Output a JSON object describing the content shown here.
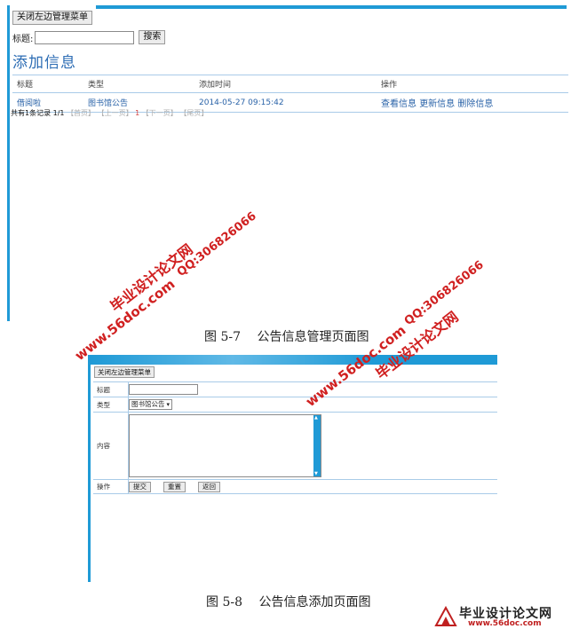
{
  "screen1": {
    "close_menu_button": "关闭左边管理菜单",
    "search": {
      "label": "标题:",
      "value": "",
      "button": "搜索"
    },
    "page_title": "添加信息",
    "table": {
      "headers": [
        "标题",
        "类型",
        "添加时间",
        "操作"
      ],
      "rows": [
        {
          "title": "借阅啦",
          "type": "图书馆公告",
          "time": "2014-05-27 09:15:42",
          "actions": [
            "查看信息",
            "更新信息",
            "删除信息"
          ]
        }
      ]
    },
    "pager": {
      "summary": "共有1条记录",
      "pages": "1/1",
      "first": "【首页】",
      "prev": "【上一页】",
      "current": "1",
      "next": "【下一页】",
      "last": "【尾页】"
    }
  },
  "caption1": "图 5-7　 公告信息管理页面图",
  "screen2": {
    "close_menu_button": "关闭左边管理菜单",
    "form": {
      "title_label": "标题",
      "title_value": "",
      "type_label": "类型",
      "type_selected": "图书馆公告",
      "content_label": "内容",
      "content_value": "",
      "actions_label": "操作",
      "buttons": [
        "提交",
        "重置",
        "返回"
      ]
    }
  },
  "caption2": "图 5-8　 公告信息添加页面图",
  "watermarks": [
    {
      "site": "www.56doc.com",
      "qq": "QQ:306826066",
      "title": "毕业设计论文网"
    },
    {
      "site": "www.56doc.com",
      "qq": "QQ:306826066",
      "title": "毕业设计论文网"
    }
  ],
  "logo": {
    "name": "毕业设计论文网",
    "site": "www.56doc.com"
  },
  "colors": {
    "accent": "#1f9ad6",
    "link": "#2a63a8",
    "watermark": "#d02020",
    "border": "#a9cbe8"
  }
}
